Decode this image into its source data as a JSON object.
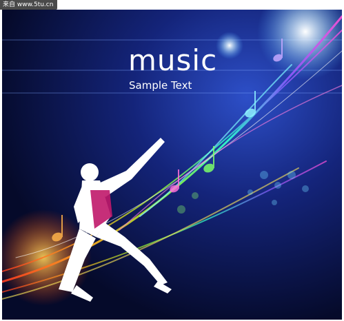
{
  "watermark": {
    "text": "来自 www.5tu.cn"
  },
  "poster": {
    "headline": "music",
    "subtitle": "Sample Text"
  }
}
